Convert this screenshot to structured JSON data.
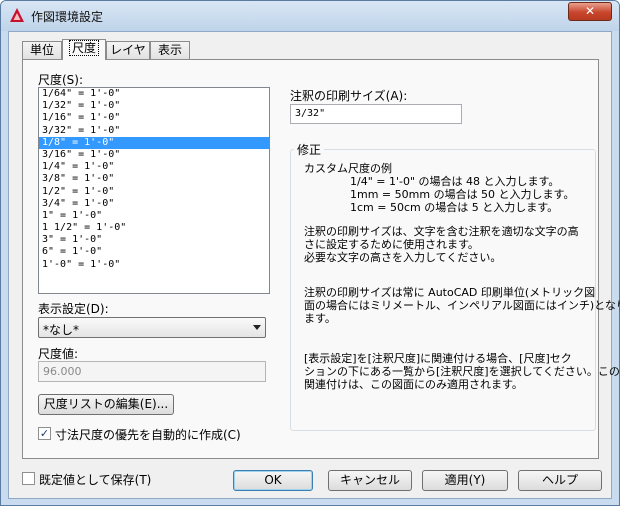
{
  "window": {
    "title": "作図環境設定",
    "close_symbol": "✕"
  },
  "tabs": [
    {
      "label": "単位",
      "active": false
    },
    {
      "label": "尺度",
      "active": true
    },
    {
      "label": "レイヤ",
      "active": false
    },
    {
      "label": "表示",
      "active": false
    }
  ],
  "scale_panel": {
    "label": "尺度(S):",
    "items": [
      "1/64\" = 1'-0\"",
      "1/32\" = 1'-0\"",
      "1/16\" = 1'-0\"",
      "3/32\" = 1'-0\"",
      "1/8\" = 1'-0\"",
      "3/16\" = 1'-0\"",
      "1/4\" = 1'-0\"",
      "3/8\" = 1'-0\"",
      "1/2\" = 1'-0\"",
      "3/4\" = 1'-0\"",
      "1\" = 1'-0\"",
      "1 1/2\" = 1'-0\"",
      "3\" = 1'-0\"",
      "6\" = 1'-0\"",
      "1'-0\" = 1'-0\""
    ],
    "selected_index": 4,
    "display_setting_label": "表示設定(D):",
    "display_setting_value": "*なし*",
    "scale_value_label": "尺度値:",
    "scale_value": "96.000",
    "edit_list_button": "尺度リストの編集(E)...",
    "auto_dimscale_label": "寸法尺度の優先を自動的に作成(C)",
    "auto_dimscale_checked": true,
    "check_symbol": "✓"
  },
  "annotation": {
    "label": "注釈の印刷サイズ(A):",
    "value": "3/32\""
  },
  "modify_group": {
    "title": "修正",
    "custom_example_heading": "カスタム尺度の例",
    "examples": [
      "1/4\" = 1'-0\" の場合は 48 と入力します。",
      "1mm = 50mm の場合は 50 と入力します。",
      "1cm = 50cm の場合は 5 と入力します。"
    ],
    "para1": [
      "注釈の印刷サイズは、文字を含む注釈を適切な文字の高",
      "さに設定するために使用されます。",
      "必要な文字の高さを入力してください。"
    ],
    "para2": [
      "注釈の印刷サイズは常に AutoCAD 印刷単位(メトリック図",
      "面の場合にはミリメートル、インペリアル図面にはインチ)となり",
      "ます。"
    ],
    "para3": [
      "[表示設定]を[注釈尺度]に関連付ける場合、[尺度]セク",
      "ションの下にある一覧から[注釈尺度]を選択してください。この",
      "関連付けは、この図面にのみ適用されます。"
    ]
  },
  "footer": {
    "save_default_label": "既定値として保存(T)",
    "save_default_checked": false,
    "ok": "OK",
    "cancel": "キャンセル",
    "apply": "適用(Y)",
    "help": "ヘルプ"
  }
}
